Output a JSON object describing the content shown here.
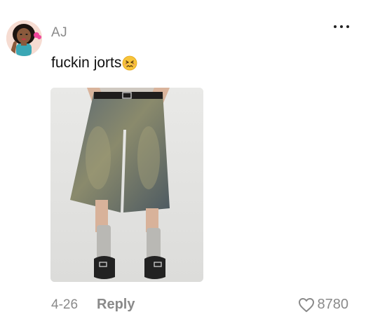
{
  "comment": {
    "author": "AJ",
    "text": "fuckin jorts",
    "emoji": "persevering-face-emoji",
    "date": "4-26",
    "reply_label": "Reply",
    "like_count": "8780"
  },
  "icons": {
    "more": "more-dots-icon",
    "like": "heart-outline-icon"
  },
  "colors": {
    "muted_text": "#8a8a8a",
    "body_text": "#111111",
    "background": "#ffffff"
  }
}
